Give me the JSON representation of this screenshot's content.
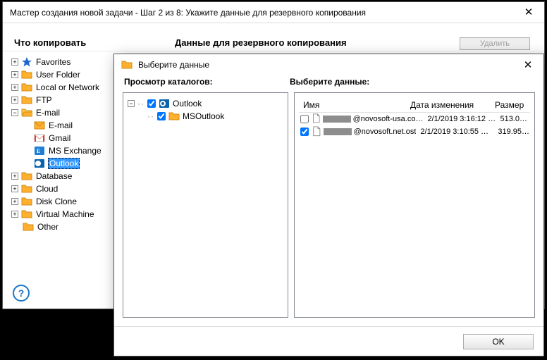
{
  "mainWindow": {
    "title": "Мастер создания новой задачи - Шаг 2 из 8: Укажите данные для резервного копирования",
    "whatToCopy": "Что копировать",
    "backupData": "Данные для резервного копирования",
    "deleteBtn": "Удалить",
    "tree": {
      "favorites": "Favorites",
      "userFolder": "User Folder",
      "localNetwork": "Local or Network",
      "ftp": "FTP",
      "email": "E-mail",
      "emailSub": "E-mail",
      "gmail": "Gmail",
      "msExchange": "MS Exchange",
      "outlook": "Outlook",
      "database": "Database",
      "cloud": "Cloud",
      "diskClone": "Disk Clone",
      "virtualMachine": "Virtual Machine",
      "other": "Other"
    },
    "helpTooltip": "?"
  },
  "dialog": {
    "title": "Выберите данные",
    "catalogLabel": "Просмотр каталогов:",
    "filesLabel": "Выберите данные:",
    "catalog": {
      "outlook": "Outlook",
      "msoutlook": "MSOutlook"
    },
    "columns": {
      "name": "Имя",
      "date": "Дата изменения",
      "size": "Размер"
    },
    "files": [
      {
        "checked": false,
        "suffix": "@novosoft-usa.co…",
        "date": "2/1/2019 3:16:12 …",
        "size": "513.00…"
      },
      {
        "checked": true,
        "suffix": "@novosoft.net.ost",
        "date": "2/1/2019 3:10:55 …",
        "size": "319.95…"
      }
    ],
    "ok": "OK"
  }
}
